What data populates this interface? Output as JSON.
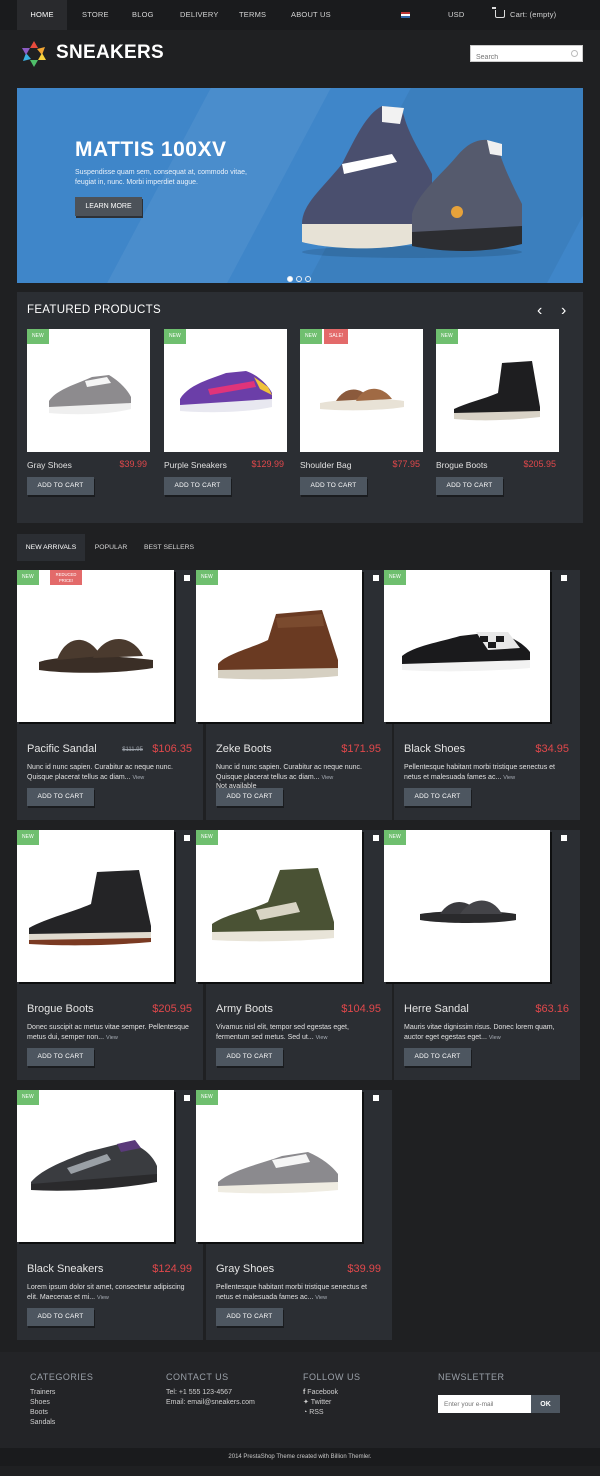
{
  "nav": {
    "items": [
      "HOME",
      "STORE",
      "BLOG",
      "DELIVERY",
      "TERMS",
      "ABOUT US"
    ],
    "currency": "USD",
    "cart": "Cart: (empty)"
  },
  "header": {
    "logo": "SNEAKERS",
    "search_placeholder": "Search"
  },
  "hero": {
    "title": "MATTIS 100XV",
    "text": "Suspendisse quam sem, consequat at, commodo vitae, feugiat in, nunc. Morbi imperdiet augue.",
    "button": "LEARN MORE"
  },
  "featured": {
    "title": "FEATURED PRODUCTS",
    "prev": "‹",
    "next": "›",
    "products": [
      {
        "name": "Gray Shoes",
        "price": "$39.99",
        "badge": "NEW",
        "sale": ""
      },
      {
        "name": "Purple Sneakers",
        "price": "$129.99",
        "badge": "NEW",
        "sale": ""
      },
      {
        "name": "Shoulder Bag",
        "price": "$77.95",
        "badge": "NEW",
        "sale": "SALE!"
      },
      {
        "name": "Brogue Boots",
        "price": "$205.95",
        "badge": "NEW",
        "sale": ""
      }
    ],
    "add_to_cart": "ADD TO CART"
  },
  "tabs": [
    "NEW ARRIVALS",
    "POPULAR",
    "BEST SELLERS"
  ],
  "grid": {
    "add_to_cart": "ADD TO CART",
    "view": "View",
    "products": [
      {
        "name": "Pacific Sandal",
        "old_price": "$111.95",
        "price": "$106.35",
        "badge": "NEW",
        "sale": "REDUCED PRICE!",
        "desc": "Nunc id nunc sapien. Curabitur ac neque nunc. Quisque placerat tellus ac diam...",
        "avail": ""
      },
      {
        "name": "Zeke Boots",
        "old_price": "",
        "price": "$171.95",
        "badge": "NEW",
        "sale": "",
        "desc": "Nunc id nunc sapien. Curabitur ac neque nunc. Quisque placerat tellus ac diam...",
        "avail": "Not available"
      },
      {
        "name": "Black Shoes",
        "old_price": "",
        "price": "$34.95",
        "badge": "NEW",
        "sale": "",
        "desc": "Pellentesque habitant morbi tristique senectus et netus et malesuada fames ac...",
        "avail": ""
      },
      {
        "name": "Brogue Boots",
        "old_price": "",
        "price": "$205.95",
        "badge": "NEW",
        "sale": "",
        "desc": "Donec suscipit ac metus vitae semper. Pellentesque metus dui, semper non...",
        "avail": ""
      },
      {
        "name": "Army Boots",
        "old_price": "",
        "price": "$104.95",
        "badge": "NEW",
        "sale": "",
        "desc": "Vivamus nisl elit, tempor sed egestas eget, fermentum sed metus. Sed ut...",
        "avail": ""
      },
      {
        "name": "Herre Sandal",
        "old_price": "",
        "price": "$63.16",
        "badge": "NEW",
        "sale": "",
        "desc": "Mauris vitae dignissim risus. Donec lorem quam, auctor eget egestas eget...",
        "avail": ""
      },
      {
        "name": "Black Sneakers",
        "old_price": "",
        "price": "$124.99",
        "badge": "NEW",
        "sale": "",
        "desc": "Lorem ipsum dolor sit amet, consectetur adipiscing elit. Maecenas et mi...",
        "avail": ""
      },
      {
        "name": "Gray Shoes",
        "old_price": "",
        "price": "$39.99",
        "badge": "NEW",
        "sale": "",
        "desc": "Pellentesque habitant morbi tristique senectus et netus et malesuada fames ac...",
        "avail": ""
      }
    ]
  },
  "footer": {
    "categories": {
      "title": "CATEGORIES",
      "items": [
        "Trainers",
        "Shoes",
        "Boots",
        "Sandals"
      ]
    },
    "contact": {
      "title": "CONTACT US",
      "tel": "Tel: +1 555 123-4567",
      "email": "Email: email@sneakers.com"
    },
    "follow": {
      "title": "FOLLOW US",
      "items": [
        "Facebook",
        "Twitter",
        "RSS"
      ]
    },
    "newsletter": {
      "title": "NEWSLETTER",
      "placeholder": "Enter your e-mail",
      "button": "OK"
    },
    "copyright": "2014 PrestaShop Theme created with Billion Themler."
  },
  "colors": {
    "accent_price": "#e0484b",
    "badge_new": "#6fbf6f",
    "badge_sale": "#e36a6a",
    "hero_bg": "#3f86c9"
  }
}
